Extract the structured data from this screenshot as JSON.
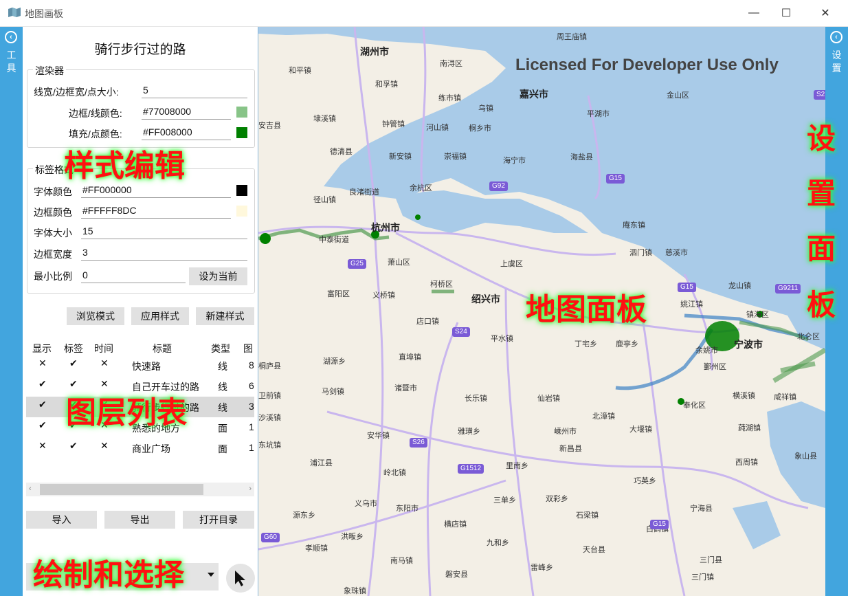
{
  "window": {
    "title": "地图画板",
    "minimize": "—",
    "maximize": "☐",
    "close": "✕"
  },
  "left_strip": {
    "toggle": "‹",
    "label": [
      "工",
      "具"
    ]
  },
  "right_strip": {
    "toggle": "‹",
    "label": [
      "设",
      "置"
    ]
  },
  "panel": {
    "title": "骑行步行过的路",
    "renderer": {
      "group_title": "渲染器",
      "line_width_label": "线宽/边框宽/点大小:",
      "line_width_value": "5",
      "border_color_label": "边框/线颜色:",
      "border_color_value": "#77008000",
      "fill_color_label": "填充/点颜色:",
      "fill_color_value": "#FF008000"
    },
    "label_format": {
      "group_title": "标签格式",
      "font_color_label": "字体颜色",
      "font_color_value": "#FF000000",
      "border_color_label": "边框颜色",
      "border_color_value": "#FFFFF8DC",
      "font_size_label": "字体大小",
      "font_size_value": "15",
      "border_width_label": "边框宽度",
      "border_width_value": "3",
      "min_scale_label": "最小比例",
      "min_scale_value": "0",
      "set_current_button": "设为当前"
    },
    "style_buttons": {
      "browse": "浏览模式",
      "apply": "应用样式",
      "new": "新建样式"
    },
    "layer_grid": {
      "headers": [
        "显示",
        "标签",
        "时间",
        "标题",
        "类型",
        "图"
      ],
      "rows": [
        {
          "show": "✕",
          "label": "✔",
          "time": "✕",
          "title": "快速路",
          "type": "线",
          "count": "8"
        },
        {
          "show": "✔",
          "label": "✔",
          "time": "✕",
          "title": "自己开车过的路",
          "type": "线",
          "count": "6"
        },
        {
          "show": "✔",
          "label": "✔",
          "time": "✕",
          "title": "骑行步行过的路",
          "type": "线",
          "count": "3"
        },
        {
          "show": "✔",
          "label": "✔",
          "time": "✕",
          "title": "熟悉的地方",
          "type": "面",
          "count": "1"
        },
        {
          "show": "✕",
          "label": "✔",
          "time": "✕",
          "title": "商业广场",
          "type": "面",
          "count": "1"
        }
      ]
    },
    "io_buttons": {
      "import": "导入",
      "export": "导出",
      "open_dir": "打开目录"
    }
  },
  "map": {
    "watermark": "Licensed For Developer Use Only",
    "places": {
      "p1": "湖州市",
      "p2": "和平镇",
      "p3": "和孚镇",
      "p4": "安吉县",
      "p5": "埭溪镇",
      "p6": "钟管镇",
      "p7": "德清县",
      "p8": "新安镇",
      "p9": "崇福镇",
      "p10": "良渚街道",
      "p11": "余杭区",
      "p12": "径山镇",
      "p13": "杭州市",
      "p14": "中泰街道",
      "p15": "萧山区",
      "p16": "富阳区",
      "p17": "义桥镇",
      "p18": "柯桥区",
      "p19": "绍兴市",
      "p20": "桐庐县",
      "p21": "诸暨市",
      "p22": "嵊州市",
      "p23": "新昌县",
      "p24": "浦江县",
      "p25": "义乌市",
      "p26": "东阳市",
      "p27": "磐安县",
      "p28": "天台县",
      "p29": "宁海县",
      "p30": "三门县",
      "p31": "奉化区",
      "p32": "鄞州区",
      "p33": "宁波市",
      "p34": "北仑区",
      "p35": "象山县",
      "p36": "慈溪市",
      "p37": "余姚市",
      "p38": "上虞区",
      "p39": "嘉兴市",
      "p40": "海宁市",
      "p41": "海盐县",
      "p42": "平湖市",
      "p43": "桐乡市",
      "p44": "金山区",
      "p45": "南浔区",
      "p46": "练市镇",
      "p47": "乌镇",
      "p48": "河山镇",
      "p49": "周王庙镇",
      "p50": "庵东镇",
      "p51": "龙山镇",
      "p52": "镇海区",
      "p53": "横溪镇",
      "p54": "咸祥镇",
      "p55": "莼湖镇",
      "p56": "西周镇",
      "p57": "大堰镇",
      "p58": "石梁镇",
      "p59": "白鹤镇",
      "p60": "三门镇",
      "p61": "洪畈乡",
      "p62": "里南乡",
      "p63": "雅璜乡",
      "p64": "平水镇",
      "p65": "店口镇",
      "p66": "直埠镇",
      "p67": "安华镇",
      "p68": "马剑镇",
      "p69": "岭北镇",
      "p70": "横店镇",
      "p71": "三单乡",
      "p72": "双彩乡",
      "p73": "巧英乡",
      "p74": "九和乡",
      "p75": "雷峰乡",
      "p76": "南马镇",
      "p77": "象珠镇",
      "p78": "孝顺镇",
      "p79": "源东乡",
      "p80": "卫前镇",
      "p81": "仙岩镇",
      "p82": "北漳镇",
      "p83": "长乐镇",
      "p84": "沙溪镇",
      "p85": "东坑镇",
      "p86": "湖源乡",
      "p87": "姚江镇",
      "p88": "泗门镇",
      "p89": "丁宅乡",
      "p90": "鹿亭乡"
    },
    "shields": {
      "g92": "G92",
      "g15a": "G15",
      "g15b": "G15",
      "g25": "G25",
      "s24": "S24",
      "s26": "S26",
      "g1512": "G1512",
      "g60": "G60",
      "g15c": "G15",
      "g9211": "G9211",
      "s2": "S2"
    }
  },
  "overlays": {
    "style_edit": "样式编辑",
    "layer_list": "图层列表",
    "draw_select": "绘制和选择",
    "map_panel": "地图面板",
    "settings_panel": [
      "设",
      "置",
      "面",
      "板"
    ]
  },
  "colors": {
    "accent": "#42a5de",
    "overlay_text": "#ff1111",
    "track_green": "#008000",
    "track_blue": "#3b82c4"
  }
}
